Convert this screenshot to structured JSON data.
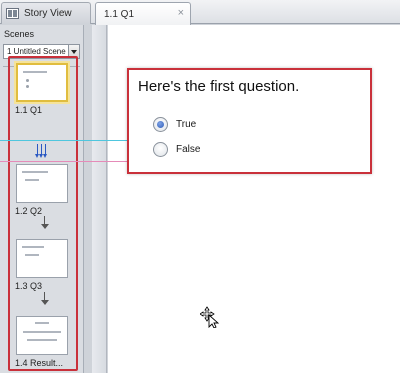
{
  "tabs": {
    "story_view": "Story View",
    "current": "1.1 Q1",
    "close_glyph": "×"
  },
  "scenes_panel": {
    "label": "Scenes",
    "scene_selector": "1 Untitled Scene",
    "slides": [
      {
        "label": "1.1 Q1",
        "selected": true
      },
      {
        "label": "1.2 Q2",
        "selected": false
      },
      {
        "label": "1.3 Q3",
        "selected": false
      },
      {
        "label": "1.4 Result...",
        "selected": false
      }
    ]
  },
  "slide": {
    "question": "Here's the first question.",
    "choices": [
      {
        "label": "True",
        "checked": true
      },
      {
        "label": "False",
        "checked": false
      }
    ]
  },
  "colors": {
    "highlight_border": "#c9303a",
    "selected_thumb": "#e0bd3f",
    "branch_arrow": "#2b59c3",
    "radio_checked": "#2f5db8"
  },
  "icons": [
    "story-view-icon",
    "close-icon",
    "dropdown-arrow-icon",
    "branch-arrow-icon",
    "move-cursor-icon"
  ]
}
